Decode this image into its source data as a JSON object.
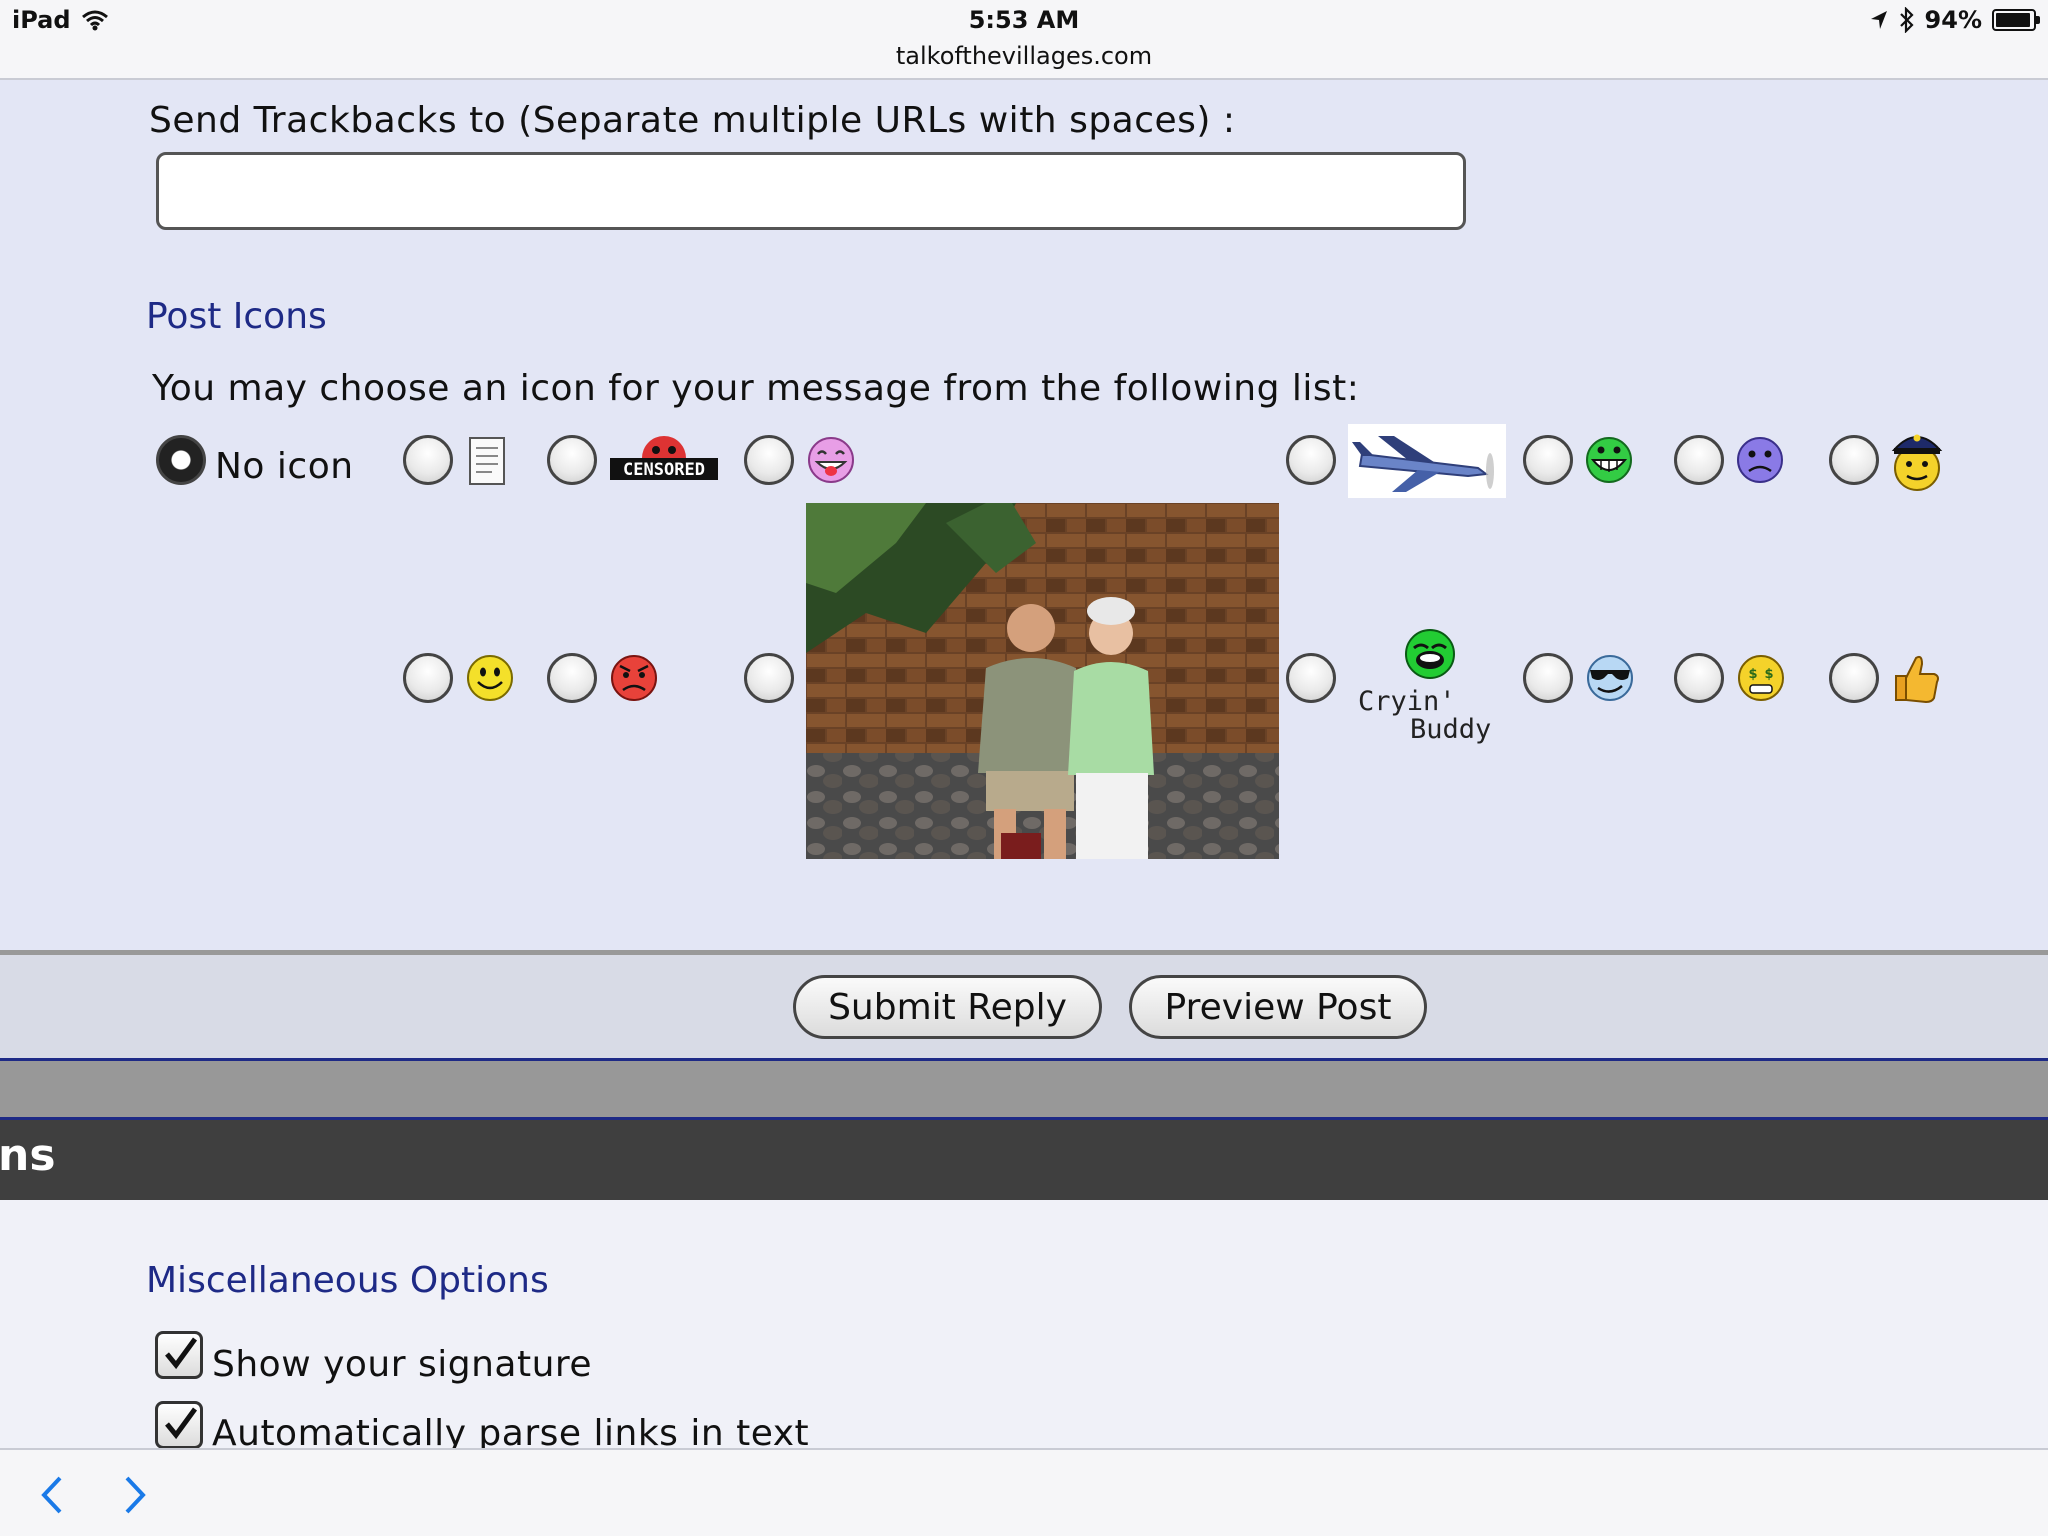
{
  "status_bar": {
    "device": "iPad",
    "time": "5:53 AM",
    "url": "talkofthevillages.com",
    "battery": "94%",
    "battery_level": 0.94
  },
  "trackbacks": {
    "label": "Send Trackbacks to (Separate multiple URLs with spaces) :",
    "value": ""
  },
  "post_icons": {
    "title": "Post Icons",
    "instruction": "You may choose an icon for your message from the following list:",
    "no_icon_label": "No icon",
    "selected": "no-icon",
    "cryin_buddy_line1": "Cryin'",
    "cryin_buddy_line2": "Buddy",
    "censored_text": "CENSORED"
  },
  "actions": {
    "submit_label": "Submit Reply",
    "preview_label": "Preview Post"
  },
  "section_header_partial": "ns",
  "misc": {
    "title": "Miscellaneous Options",
    "options": [
      {
        "label": "Show your signature",
        "checked": true
      },
      {
        "label": "Automatically parse links in text",
        "checked": true
      }
    ]
  },
  "colors": {
    "accent": "#1e2a86",
    "page_bg": "#e3e6f5",
    "dark_band": "#3f3f3f"
  }
}
